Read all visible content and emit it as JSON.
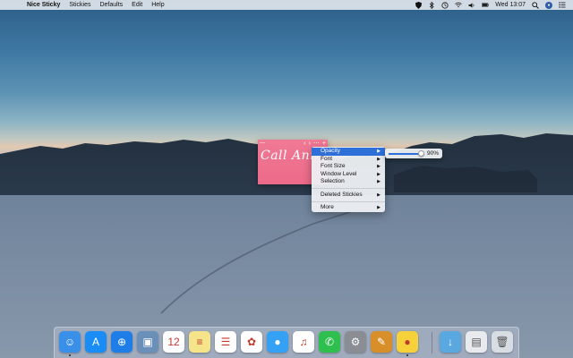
{
  "menubar": {
    "app_name": "Nice Sticky",
    "items": [
      "Stickies",
      "Defaults",
      "Edit",
      "Help"
    ],
    "clock": "Wed 13:07"
  },
  "sticky": {
    "text": "Call Ann",
    "close_glyph": "—",
    "prev_glyph": "‹",
    "next_glyph": "›",
    "more_glyph": "⋯",
    "add_glyph": "+"
  },
  "context_menu": {
    "items": [
      {
        "label": "Opacity",
        "has_submenu": true,
        "active": true
      },
      {
        "label": "Font",
        "has_submenu": true,
        "active": false
      },
      {
        "label": "Font Size",
        "has_submenu": true,
        "active": false
      },
      {
        "label": "Window Level",
        "has_submenu": true,
        "active": false
      },
      {
        "label": "Selection",
        "has_submenu": true,
        "active": false
      }
    ],
    "group2": [
      {
        "label": "Deleted Stickies",
        "has_submenu": true
      }
    ],
    "group3": [
      {
        "label": "More",
        "has_submenu": true
      }
    ]
  },
  "opacity_submenu": {
    "value": 0.9,
    "label": "90%"
  },
  "dock": {
    "apps": [
      {
        "name": "finder-icon",
        "color": "#3a8fe8",
        "glyph": "☺",
        "running": true
      },
      {
        "name": "app-store-icon",
        "color": "#1a8cf5",
        "glyph": "A",
        "running": false
      },
      {
        "name": "safari-icon",
        "color": "#1f7de8",
        "glyph": "⊕",
        "running": false
      },
      {
        "name": "preview-icon",
        "color": "#6a8fb8",
        "glyph": "▣",
        "running": false
      },
      {
        "name": "calendar-icon",
        "color": "#ffffff",
        "glyph": "12",
        "running": false
      },
      {
        "name": "notes-icon",
        "color": "#f5e48a",
        "glyph": "≡",
        "running": false
      },
      {
        "name": "reminders-icon",
        "color": "#ffffff",
        "glyph": "☰",
        "running": false
      },
      {
        "name": "photos-icon",
        "color": "#ffffff",
        "glyph": "✿",
        "running": false
      },
      {
        "name": "messages-icon",
        "color": "#35a1f5",
        "glyph": "●",
        "running": false
      },
      {
        "name": "music-icon",
        "color": "#ffffff",
        "glyph": "♫",
        "running": false
      },
      {
        "name": "facetime-icon",
        "color": "#2fbf4f",
        "glyph": "✆",
        "running": false
      },
      {
        "name": "system-preferences-icon",
        "color": "#8a8d93",
        "glyph": "⚙",
        "running": false
      },
      {
        "name": "script-editor-icon",
        "color": "#d88f2a",
        "glyph": "✎",
        "running": false
      },
      {
        "name": "nice-sticky-icon",
        "color": "#f7d13a",
        "glyph": "●",
        "running": true
      }
    ],
    "others": [
      {
        "name": "downloads-folder-icon",
        "color": "#5aa8e0",
        "glyph": "↓"
      },
      {
        "name": "screenshot-stack-icon",
        "color": "#e8eaee",
        "glyph": "▤"
      },
      {
        "name": "trash-icon",
        "color": "#d8dde4",
        "glyph": "🗑"
      }
    ]
  }
}
